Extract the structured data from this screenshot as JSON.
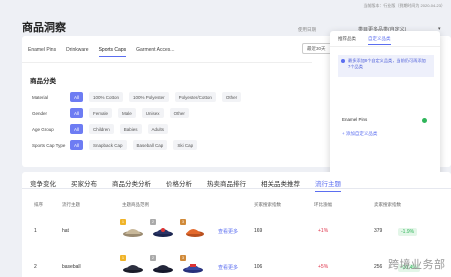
{
  "top_bar": {
    "version": "当前版本：行业版（到期时间为 2020-04-23）"
  },
  "page_title": "商品洞察",
  "header": {
    "range_label": "使用日期",
    "range_value": "类目更多品类(自定义)"
  },
  "categories": [
    "Enamel Pins",
    "Drinkware",
    "Sports Caps",
    "Garment Acces..."
  ],
  "active_category": 2,
  "date_range": "最近30天",
  "section_title": "商品分类",
  "filters": [
    {
      "label": "Material",
      "options": [
        "All",
        "100% Cotton",
        "100% Polyester",
        "Polyester/Cotton",
        "Other"
      ]
    },
    {
      "label": "Gender",
      "options": [
        "All",
        "Female",
        "Male",
        "Unisex",
        "Other"
      ]
    },
    {
      "label": "Age Group",
      "options": [
        "All",
        "Children",
        "Babies",
        "Adults"
      ]
    },
    {
      "label": "Sports Cap Type",
      "options": [
        "All",
        "Snapback Cap",
        "Baseball Cap",
        "Ski Cap"
      ]
    }
  ],
  "dropdown": {
    "tabs": [
      "推荐品类",
      "自定义品类"
    ],
    "active_tab": 1,
    "note": "最多添加8个自定义品类，当前仍可再添加7个品类",
    "items": [
      {
        "name": "Enamel Pins",
        "checked": true
      }
    ],
    "add_label": "+ 添加自定义品类"
  },
  "analysis_tabs": [
    "竞争变化",
    "买家分布",
    "商品分类分析",
    "价格分析",
    "热卖商品排行",
    "相关品类推荐",
    "流行主题"
  ],
  "active_analysis_tab": 6,
  "table": {
    "headers": [
      "排序",
      "流行主题",
      "主题商品范例",
      "买家搜索指数",
      "环比涨幅",
      "卖家搜索指数"
    ],
    "rows": [
      {
        "rank": "1",
        "theme": "hat",
        "see_more": "查看更多",
        "buyer_index": "169",
        "mom": "+1%",
        "seller_index": "379",
        "seller_mom": "-1.9%",
        "thumb_colors": [
          "#c8b89a",
          "#2a3466",
          "#e3692c"
        ]
      },
      {
        "rank": "2",
        "theme": "baseball",
        "see_more": "查看更多",
        "buyer_index": "106",
        "mom": "+5%",
        "seller_index": "256",
        "seller_mom": "-20.4%",
        "thumb_colors": [
          "#2d3040",
          "#23263a",
          "#3a4aa0"
        ]
      }
    ]
  },
  "watermark": "跨境业务部"
}
